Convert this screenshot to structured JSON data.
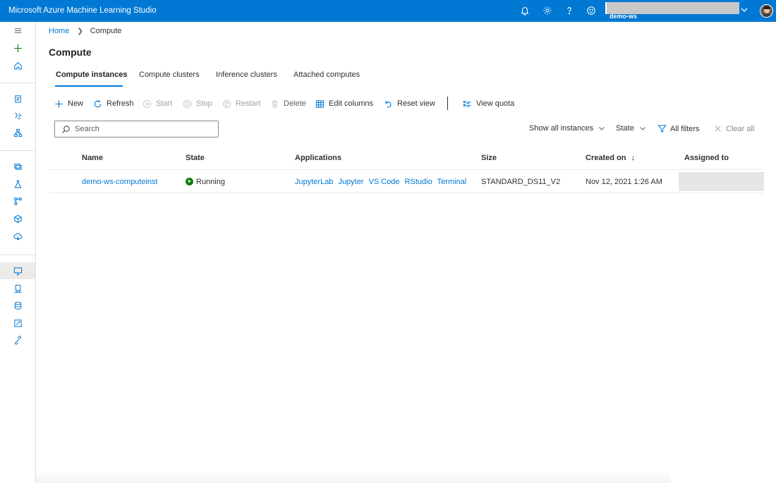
{
  "app": {
    "title": "Microsoft Azure Machine Learning Studio"
  },
  "topbar": {
    "icons": [
      "bell-icon",
      "gear-icon",
      "help-icon",
      "smiley-icon"
    ],
    "workspace": "demo-ws",
    "colors": {
      "bar": "#0078d4",
      "accent": "#0078d4"
    }
  },
  "breadcrumb": {
    "home": "Home",
    "current": "Compute"
  },
  "page": {
    "title": "Compute"
  },
  "tabs": [
    {
      "label": "Compute instances",
      "active": true
    },
    {
      "label": "Compute clusters",
      "active": false
    },
    {
      "label": "Inference clusters",
      "active": false
    },
    {
      "label": "Attached computes",
      "active": false
    }
  ],
  "toolbar": {
    "new": "New",
    "refresh": "Refresh",
    "start": "Start",
    "stop": "Stop",
    "restart": "Restart",
    "delete": "Delete",
    "edit_columns": "Edit columns",
    "reset_view": "Reset view",
    "view_quota": "View quota"
  },
  "search": {
    "placeholder": "Search",
    "value": ""
  },
  "filters": {
    "show": "Show all instances",
    "state": "State",
    "all_filters": "All filters",
    "clear_all": "Clear all"
  },
  "table": {
    "columns": {
      "name": "Name",
      "state": "State",
      "applications": "Applications",
      "size": "Size",
      "created": "Created on",
      "created_sort": "↓",
      "assigned": "Assigned to"
    },
    "rows": [
      {
        "name": "demo-ws-computeinst",
        "state": "Running",
        "apps": [
          "JupyterLab",
          "Jupyter",
          "VS Code",
          "RStudio",
          "Terminal"
        ],
        "size": "STANDARD_DS11_V2",
        "created": "Nov 12, 2021 1:26 AM"
      }
    ]
  }
}
